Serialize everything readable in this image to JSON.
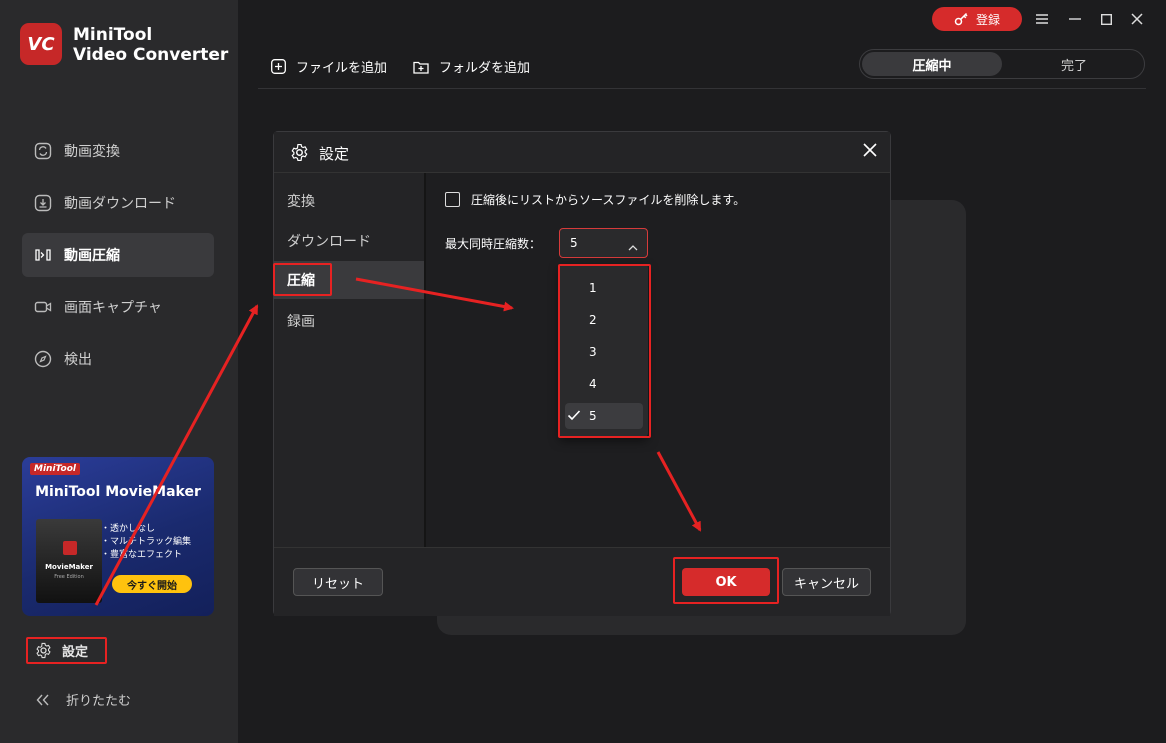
{
  "app": {
    "logo_text": "VC",
    "title_line1": "MiniTool",
    "title_line2": "Video Converter"
  },
  "sidebar": {
    "items": [
      {
        "label": "動画変換",
        "icon": "convert-icon"
      },
      {
        "label": "動画ダウンロード",
        "icon": "download-icon"
      },
      {
        "label": "動画圧縮",
        "icon": "compress-icon",
        "active": true
      },
      {
        "label": "画面キャプチャ",
        "icon": "camera-icon"
      },
      {
        "label": "検出",
        "icon": "compass-icon"
      }
    ],
    "settings_label": "設定",
    "collapse_label": "折りたたむ"
  },
  "promo": {
    "brand": "MiniTool",
    "title": "MiniTool MovieMaker",
    "box_name": "MovieMaker",
    "box_sub": "Free Edition",
    "features": [
      "・透かしなし",
      "・マルチトラック編集",
      "・豊富なエフェクト"
    ],
    "cta": "今すぐ開始"
  },
  "topbar": {
    "register_label": "登録",
    "add_file_label": "ファイルを追加",
    "add_folder_label": "フォルダを追加",
    "tabs": [
      "圧縮中",
      "完了"
    ],
    "active_tab": "圧縮中"
  },
  "dialog": {
    "title": "設定",
    "nav": [
      "変換",
      "ダウンロード",
      "圧縮",
      "録画"
    ],
    "active_nav": "圧縮",
    "checkbox_label": "圧縮後にリストからソースファイルを削除します。",
    "checkbox_checked": false,
    "max_label": "最大同時圧縮数：",
    "select_value": "5",
    "options": [
      "1",
      "2",
      "3",
      "4",
      "5"
    ],
    "selected_option": "5",
    "reset_label": "リセット",
    "ok_label": "OK",
    "cancel_label": "キャンセル"
  },
  "colors": {
    "accent_red": "#d62b2b",
    "annotation_red": "#e62222",
    "promo_cta": "#ffc20e"
  }
}
